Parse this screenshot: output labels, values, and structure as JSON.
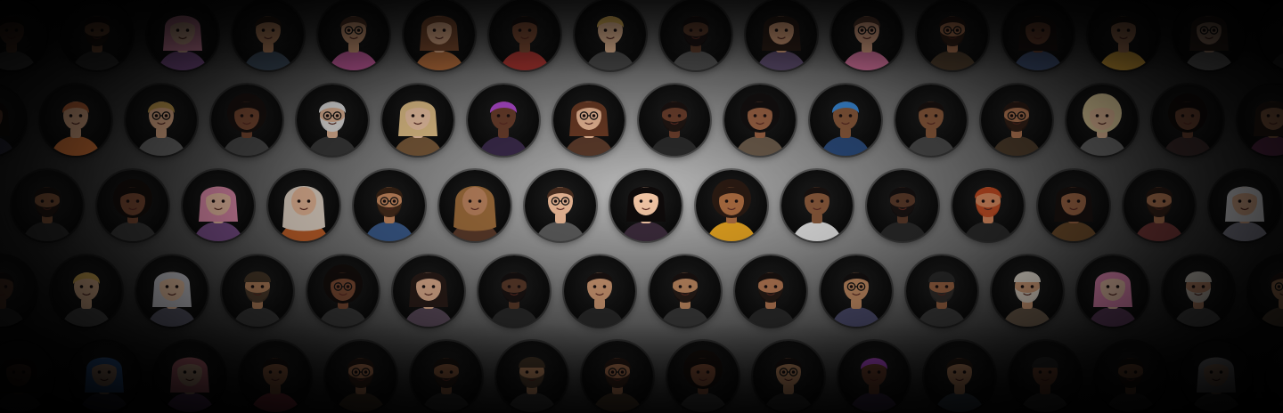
{
  "palette": {
    "background_center": "#b9b9b9",
    "background_edge": "#0d0d0d",
    "avatar_backdrop": "#111111"
  },
  "avatar_rows": [
    [
      "avatar-curly-dark",
      "avatar-man-beard",
      "avatar-woman-pink-hair",
      "avatar-man-short-hair",
      "avatar-man-glasses-curly",
      "avatar-woman-wavy-brown",
      "avatar-woman-dark-bun",
      "avatar-man-blonde",
      "avatar-man-heavy-beard",
      "avatar-woman-long-dark",
      "avatar-man-pink-hoodie",
      "avatar-man-glasses-beard",
      "avatar-woman-braids",
      "avatar-man-yellow-hoodie",
      "avatar-woman-glasses",
      "avatar-man-dark"
    ],
    [
      "avatar-woman-dark",
      "avatar-man-ginger",
      "avatar-man-glasses-blonde",
      "avatar-woman-curly-afro",
      "avatar-man-white-hair",
      "avatar-woman-blonde",
      "avatar-man-purple-hair",
      "avatar-woman-glasses-brown",
      "avatar-man-bald-beard",
      "avatar-woman-curly-black",
      "avatar-man-blue-hair",
      "avatar-man-round-face",
      "avatar-man-glasses-beard",
      "avatar-woman-curly-blonde",
      "avatar-woman-afro",
      "avatar-woman-long-hair"
    ],
    [
      "avatar-man-beard",
      "avatar-woman-curly",
      "avatar-woman-pink-hair",
      "avatar-woman-hijab-light",
      "avatar-man-glasses-waving",
      "avatar-woman-hijab-brown",
      "avatar-man-glasses-fringe",
      "avatar-woman-long-black",
      "avatar-girl-curly-smile",
      "avatar-man-hoodie",
      "avatar-man-dark-beard",
      "avatar-man-red-beard",
      "avatar-woman-crown",
      "avatar-man-short-beard",
      "avatar-woman-white-hair"
    ],
    [
      "avatar-man-dark",
      "avatar-man-blonde",
      "avatar-woman-silver-hair",
      "avatar-man-beanie",
      "avatar-woman-sunglasses-curly",
      "avatar-woman-straight-dark",
      "avatar-man-bald-dark",
      "avatar-man-swept-hair",
      "avatar-man-fade",
      "avatar-man-beard-short",
      "avatar-man-glasses-dark",
      "avatar-man-cap-beard",
      "avatar-man-kufi",
      "avatar-woman-pink-waves",
      "avatar-man-turban",
      "avatar-man-glasses"
    ],
    [
      "avatar-woman-dark",
      "avatar-woman-blue-hair",
      "avatar-woman-rainbow-hair",
      "avatar-woman-top-bun",
      "avatar-man-glasses-beard",
      "avatar-man-beard",
      "avatar-man-beanie",
      "avatar-man-glasses-beard",
      "avatar-woman-curly",
      "avatar-man-sunglasses",
      "avatar-man-purple-hair",
      "avatar-man-short-hair",
      "avatar-woman-beanie",
      "avatar-man-beard",
      "avatar-woman-grey-hair",
      "avatar-man-dark"
    ]
  ],
  "avatar_styles": {
    "avatar-curly-dark": {
      "skin": "#6b4431",
      "hair": "#1b1410",
      "top": "#3a3a3a"
    },
    "avatar-man-beard": {
      "skin": "#8a5a3c",
      "hair": "#1c1410",
      "top": "#2d2d2d",
      "beard": true
    },
    "avatar-woman-pink-hair": {
      "skin": "#f0c2a8",
      "hair": "#e58fb0",
      "top": "#7a4f8a",
      "long": true
    },
    "avatar-man-short-hair": {
      "skin": "#c58d65",
      "hair": "#2a1c14",
      "top": "#3b4a5a"
    },
    "avatar-man-glasses-curly": {
      "skin": "#d9a27c",
      "hair": "#5a3a2a",
      "top": "#c05a9a",
      "glasses": true
    },
    "avatar-woman-wavy-brown": {
      "skin": "#e5b08b",
      "hair": "#7b4a2e",
      "top": "#b06a3a",
      "long": true
    },
    "avatar-woman-dark-bun": {
      "skin": "#7b4a33",
      "hair": "#1a1210",
      "top": "#a0322e"
    },
    "avatar-man-blonde": {
      "skin": "#f0c19a",
      "hair": "#e4b85a",
      "top": "#4a4a4a"
    },
    "avatar-man-heavy-beard": {
      "skin": "#5a3a2a",
      "hair": "#161010",
      "top": "#505050",
      "beard": true
    },
    "avatar-woman-long-dark": {
      "skin": "#d8a07a",
      "hair": "#2a1c16",
      "top": "#5a4a6a",
      "long": true
    },
    "avatar-man-pink-hoodie": {
      "skin": "#e2a888",
      "hair": "#5a3b2e",
      "top": "#d0709a",
      "glasses": true
    },
    "avatar-man-glasses-beard": {
      "skin": "#b77a55",
      "hair": "#2a1a14",
      "top": "#4a3a2a",
      "glasses": true,
      "beard": true
    },
    "avatar-woman-braids": {
      "skin": "#6e4330",
      "hair": "#1a1210",
      "top": "#3a4a6a",
      "long": true
    },
    "avatar-man-yellow-hoodie": {
      "skin": "#b9825e",
      "hair": "#1e1612",
      "top": "#d8a43a"
    },
    "avatar-woman-glasses": {
      "skin": "#e3b596",
      "hair": "#3a2a22",
      "top": "#6a6a6a",
      "glasses": true,
      "long": true
    },
    "avatar-man-dark": {
      "skin": "#5a3a2a",
      "hair": "#151010",
      "top": "#2a2a2a"
    },
    "avatar-woman-dark": {
      "skin": "#6a4230",
      "hair": "#140e0c",
      "top": "#2a2a3a",
      "long": true
    },
    "avatar-man-ginger": {
      "skin": "#eab48e",
      "hair": "#c86a3a",
      "top": "#e07a3a"
    },
    "avatar-man-glasses-blonde": {
      "skin": "#eab48e",
      "hair": "#c8a050",
      "top": "#6a6a6a",
      "glasses": true
    },
    "avatar-woman-curly-afro": {
      "skin": "#7a4a33",
      "hair": "#1a1210",
      "top": "#4a4a4a",
      "afro": true
    },
    "avatar-man-white-hair": {
      "skin": "#e6b898",
      "hair": "#e8e8e8",
      "top": "#3a3a3a",
      "glasses": true,
      "beard": true
    },
    "avatar-woman-blonde": {
      "skin": "#f2c8a8",
      "hair": "#e6c48a",
      "top": "#7a5a3a",
      "long": true
    },
    "avatar-man-purple-hair": {
      "skin": "#6a3e2c",
      "hair": "#b04ad0",
      "top": "#3a2a4a"
    },
    "avatar-woman-glasses-brown": {
      "skin": "#eab896",
      "hair": "#6a3a24",
      "top": "#5a3a2a",
      "glasses": true,
      "long": true
    },
    "avatar-man-bald-beard": {
      "skin": "#6a3e2c",
      "hair": "#1a1210",
      "top": "#2a2a2a",
      "beard": true
    },
    "avatar-woman-curly-black": {
      "skin": "#9a6244",
      "hair": "#141010",
      "top": "#6a5a4a",
      "afro": true
    },
    "avatar-man-blue-hair": {
      "skin": "#8a5a3c",
      "hair": "#3a8ad8",
      "top": "#2a4a7a"
    },
    "avatar-man-round-face": {
      "skin": "#8a5a3c",
      "hair": "#1a1210",
      "top": "#4a4a4a"
    },
    "avatar-woman-curly-blonde": {
      "skin": "#f0c4a0",
      "hair": "#e6d2a0",
      "top": "#6a6a6a",
      "afro": true
    },
    "avatar-woman-afro": {
      "skin": "#6a4230",
      "hair": "#120c0a",
      "top": "#3a2a2a",
      "afro": true
    },
    "avatar-woman-long-hair": {
      "skin": "#9a6a4c",
      "hair": "#2a1c16",
      "top": "#5a2a4a",
      "long": true
    },
    "avatar-woman-curly": {
      "skin": "#7a4a33",
      "hair": "#160f0c",
      "top": "#3a3a3a",
      "afro": true
    },
    "avatar-woman-hijab-light": {
      "skin": "#e8b898",
      "hair": "#e4d6c8",
      "top": "#c0602a",
      "hijab": true
    },
    "avatar-man-glasses-waving": {
      "skin": "#c88a60",
      "hair": "#3a2416",
      "top": "#3a5a8a",
      "glasses": true,
      "beard": true
    },
    "avatar-woman-hijab-brown": {
      "skin": "#b7805c",
      "hair": "#9a6a3a",
      "top": "#5a3a2a",
      "hijab": true
    },
    "avatar-man-glasses-fringe": {
      "skin": "#eab896",
      "hair": "#4a2e20",
      "top": "#5a5a5a",
      "glasses": true
    },
    "avatar-woman-long-black": {
      "skin": "#f0c4a4",
      "hair": "#0e0a0a",
      "top": "#3a2a3a",
      "long": true
    },
    "avatar-girl-curly-smile": {
      "skin": "#a86a40",
      "hair": "#2a1a12",
      "top": "#e0a020",
      "afro": true
    },
    "avatar-man-hoodie": {
      "skin": "#8a5a3c",
      "hair": "#1a1210",
      "top": "#e0e0e0"
    },
    "avatar-man-dark-beard": {
      "skin": "#5a3a2a",
      "hair": "#151010",
      "top": "#2a2a2a",
      "beard": true
    },
    "avatar-man-red-beard": {
      "skin": "#d88a60",
      "hair": "#c04a22",
      "top": "#2a2a2a",
      "beard": true
    },
    "avatar-woman-crown": {
      "skin": "#9a6444",
      "hair": "#1a1210",
      "top": "#6a4a2a",
      "long": true
    },
    "avatar-man-short-beard": {
      "skin": "#b77a55",
      "hair": "#2a1a14",
      "top": "#7a3a3a",
      "beard": true
    },
    "avatar-woman-white-hair": {
      "skin": "#eab896",
      "hair": "#e6e6ea",
      "top": "#8a8a9a",
      "long": true
    },
    "avatar-woman-silver-hair": {
      "skin": "#f0c8a8",
      "hair": "#cfcfd6",
      "top": "#5a5a6a",
      "long": true
    },
    "avatar-man-beanie": {
      "skin": "#c08a62",
      "hair": "#4a3a2a",
      "top": "#3a3a3a",
      "beanie": true,
      "beard": true
    },
    "avatar-woman-sunglasses-curly": {
      "skin": "#7a4a33",
      "hair": "#140e0c",
      "top": "#3a3a3a",
      "afro": true,
      "glasses": true
    },
    "avatar-woman-straight-dark": {
      "skin": "#e2b090",
      "hair": "#2a1c18",
      "top": "#5a4a5a",
      "long": true
    },
    "avatar-man-bald-dark": {
      "skin": "#5a3a2a",
      "hair": "#151010",
      "top": "#2a2a2a",
      "beard": true
    },
    "avatar-man-swept-hair": {
      "skin": "#d09a74",
      "hair": "#1a1210",
      "top": "#2a2a2a"
    },
    "avatar-man-fade": {
      "skin": "#c08a62",
      "hair": "#1a1210",
      "top": "#3a3a3a",
      "beard": true
    },
    "avatar-man-beard-short": {
      "skin": "#b77a55",
      "hair": "#1a1210",
      "top": "#2a2a2a",
      "beard": true
    },
    "avatar-man-glasses-dark": {
      "skin": "#c08a62",
      "hair": "#141010",
      "top": "#4a4a6a",
      "glasses": true
    },
    "avatar-man-cap-beard": {
      "skin": "#9a6444",
      "hair": "#2a2a2a",
      "top": "#3a3a3a",
      "beanie": true,
      "beard": true
    },
    "avatar-man-kufi": {
      "skin": "#d8a27c",
      "hair": "#e8e0d4",
      "top": "#6a5a4a",
      "beanie": true,
      "beard": true
    },
    "avatar-woman-pink-waves": {
      "skin": "#f2c8b0",
      "hair": "#e88ab8",
      "top": "#5a3a5a",
      "long": true
    },
    "avatar-man-turban": {
      "skin": "#c89070",
      "hair": "#d8d2c8",
      "top": "#4a4a4a",
      "beanie": true,
      "beard": true
    },
    "avatar-man-glasses": {
      "skin": "#c08a62",
      "hair": "#2a1a14",
      "top": "#5a4a3a",
      "glasses": true
    },
    "avatar-woman-blue-hair": {
      "skin": "#e8b898",
      "hair": "#3a7ad0",
      "top": "#3a3a5a",
      "long": true
    },
    "avatar-woman-rainbow-hair": {
      "skin": "#f0c4a4",
      "hair": "#e07a8a",
      "top": "#7a4a8a",
      "long": true
    },
    "avatar-woman-top-bun": {
      "skin": "#9a6444",
      "hair": "#1a1210",
      "top": "#a03a4a"
    },
    "avatar-man-sunglasses": {
      "skin": "#c08a62",
      "hair": "#1a1210",
      "top": "#2a2a2a",
      "glasses": true
    },
    "avatar-man-short-hair-2": {
      "skin": "#b77a55",
      "hair": "#1a1210",
      "top": "#3a3a3a"
    },
    "avatar-woman-beanie": {
      "skin": "#7a4a33",
      "hair": "#2a2a2a",
      "top": "#3a3a3a",
      "beanie": true
    },
    "avatar-woman-grey-hair": {
      "skin": "#eab896",
      "hair": "#bdbdc4",
      "top": "#5a5a5a",
      "long": true
    }
  }
}
